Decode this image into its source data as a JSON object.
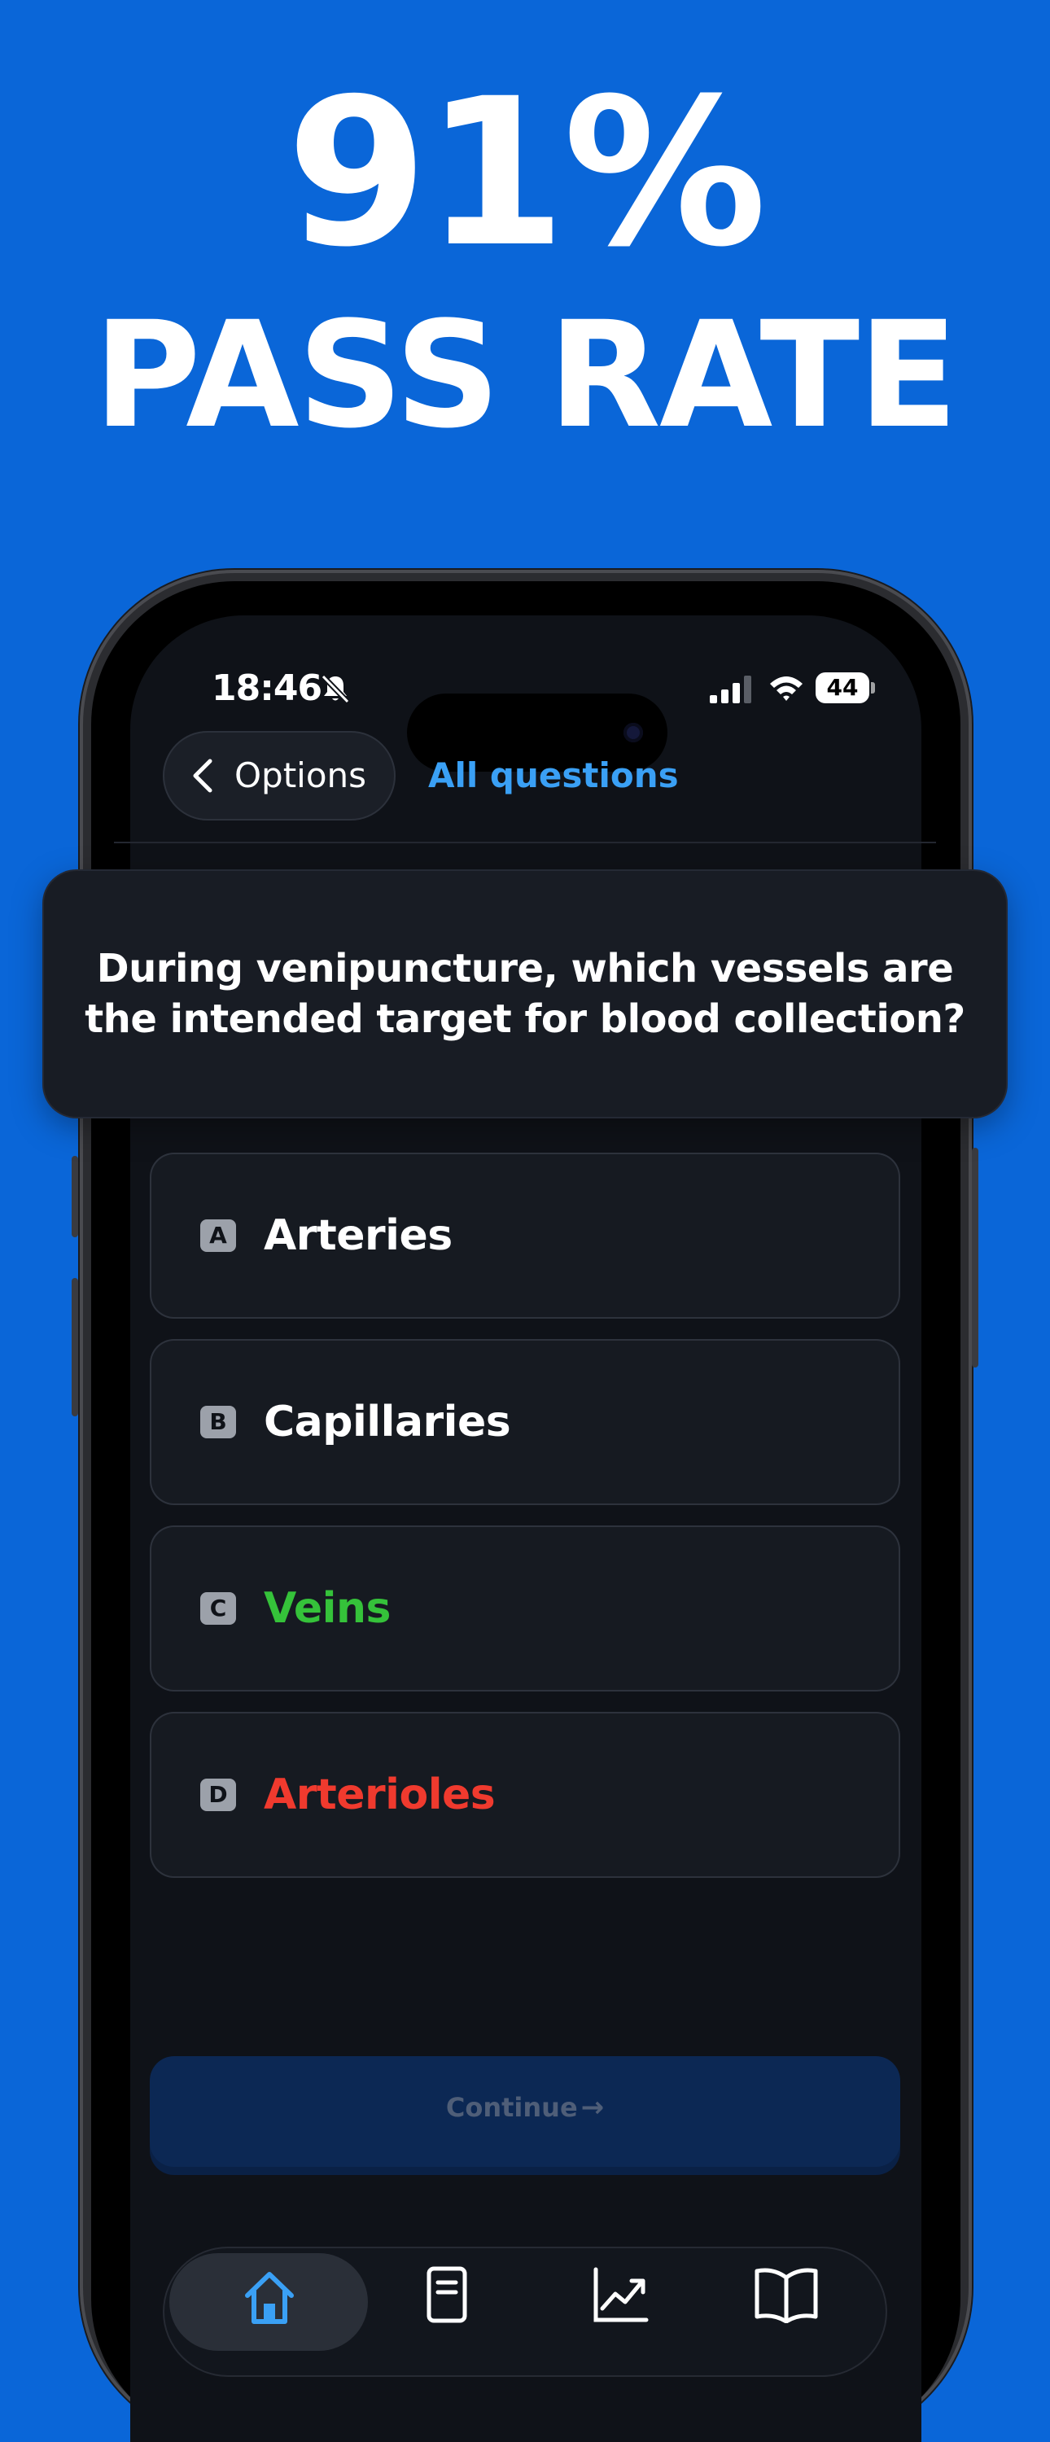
{
  "promo": {
    "headline": "91%",
    "subheadline": "PASS RATE"
  },
  "status_bar": {
    "time": "18:46",
    "battery": "44"
  },
  "nav": {
    "back_label": "Options",
    "title": "All questions"
  },
  "question": {
    "text": "During venipuncture, which vessels are the intended target for blood collection?"
  },
  "answers": [
    {
      "letter": "A",
      "text": "Arteries",
      "state": "neutral"
    },
    {
      "letter": "B",
      "text": "Capillaries",
      "state": "neutral"
    },
    {
      "letter": "C",
      "text": "Veins",
      "state": "correct"
    },
    {
      "letter": "D",
      "text": "Arterioles",
      "state": "wrong"
    }
  ],
  "continue": {
    "label": "Continue",
    "arrow": "→"
  },
  "tabbar": {
    "tabs": [
      {
        "icon": "home-icon",
        "active": true
      },
      {
        "icon": "document-icon",
        "active": false
      },
      {
        "icon": "chart-icon",
        "active": false
      },
      {
        "icon": "book-icon",
        "active": false
      }
    ]
  },
  "colors": {
    "background": "#0A66D8",
    "accent": "#3AA0F5",
    "correct": "#35C23A",
    "wrong": "#F03A2E"
  }
}
